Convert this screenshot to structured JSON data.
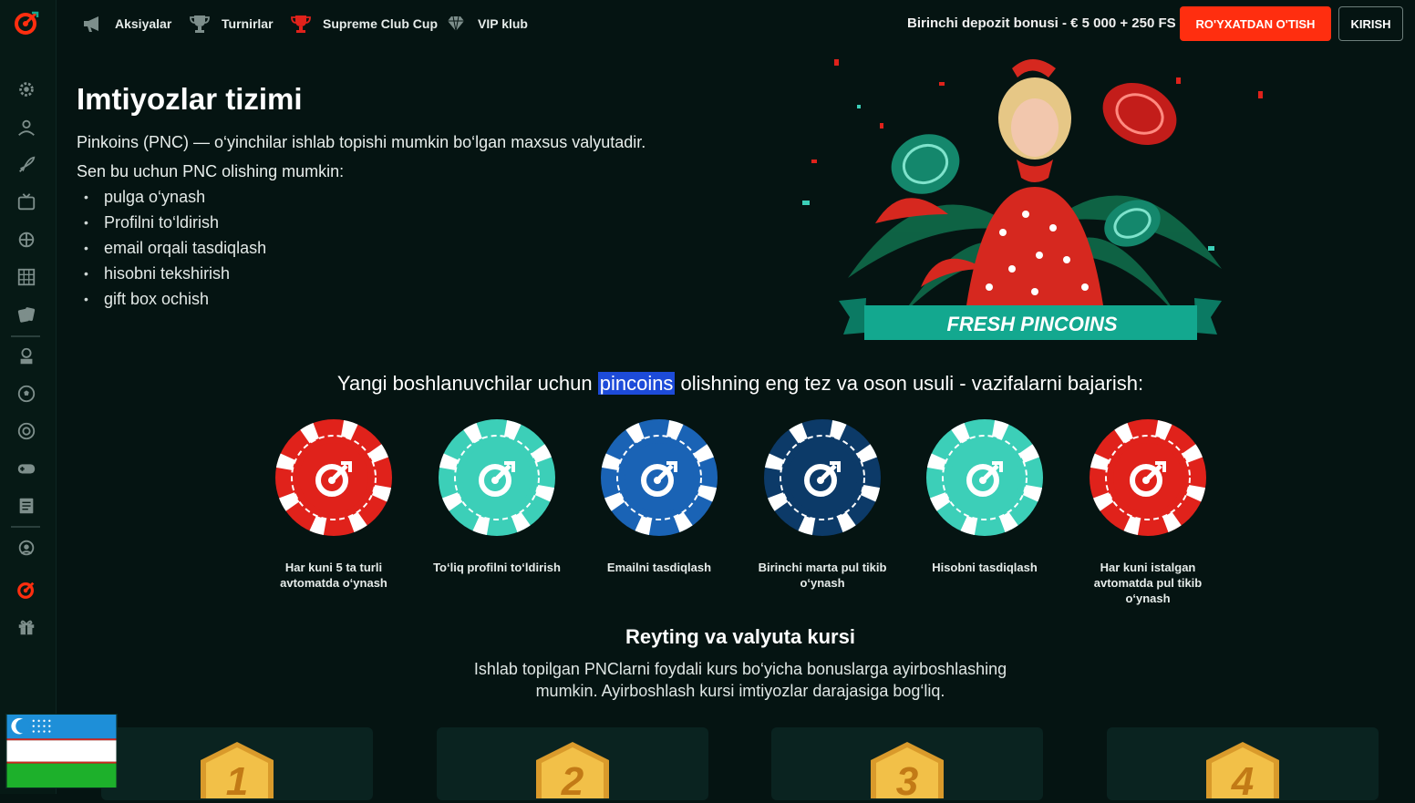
{
  "nav": {
    "items": [
      {
        "label": "Aksiyalar",
        "icon": "megaphone-icon"
      },
      {
        "label": "Turnirlar",
        "icon": "trophy-icon"
      },
      {
        "label": "Supreme Club Cup",
        "icon": "red-trophy-icon"
      },
      {
        "label": "VIP klub",
        "icon": "diamond-icon"
      }
    ],
    "bonus": "Birinchi depozit bonusi - € 5 000 + 250 FS",
    "register": "RO'YXATDAN O'TISH",
    "login": "KIRISH"
  },
  "sidebar": {
    "icons": [
      "settings-gear-icon",
      "live-dealer-icon",
      "rocket-icon",
      "tv-games-icon",
      "poker-table-icon",
      "lottery-grid-icon",
      "cards-icon",
      "esports-icon",
      "football-icon",
      "target-icon",
      "gamepad-icon",
      "news-icon",
      "support-icon",
      "logo-target-icon",
      "gift-icon"
    ]
  },
  "page": {
    "title": "Imtiyozlar tizimi",
    "intro": "Pinkoins (PNC) — o‘yinchilar ishlab topishi mumkin bo‘lgan maxsus valyutadir.",
    "intro2": "Sen bu uchun PNC olishing mumkin:",
    "list": [
      "pulga o‘ynash",
      "Profilni to‘ldirish",
      "email orqali tasdiqlash",
      "hisobni tekshirish",
      "gift box ochish"
    ],
    "banner_text": "FRESH PINCOINS",
    "tasks_heading_pre": "Yangi boshlanuvchilar uchun ",
    "tasks_heading_highlight": "pincoins",
    "tasks_heading_post": " olishning eng tez va oson usuli - vazifalarni bajarish:",
    "chips": [
      {
        "label": "Har kuni 5 ta turli avtomatda o‘ynash",
        "color": "#e0221b"
      },
      {
        "label": "To‘liq profilni to‘ldirish",
        "color": "#3ccfb8"
      },
      {
        "label": "Emailni tasdiqlash",
        "color": "#1a63b5"
      },
      {
        "label": "Birinchi marta pul tikib o‘ynash",
        "color": "#0c3a68"
      },
      {
        "label": "Hisobni tasdiqlash",
        "color": "#3ccfb8"
      },
      {
        "label": "Har kuni istalgan avtomatda pul tikib o‘ynash",
        "color": "#e0221b"
      }
    ],
    "rating_title": "Reyting va valyuta kursi",
    "rating_desc": "Ishlab topilgan PNClarni foydali kurs bo‘yicha bonuslarga ayirboshlashing mumkin. Ayirboshlash kursi imtiyozlar darajasiga bog‘liq.",
    "levels": [
      "1",
      "2",
      "3",
      "4"
    ]
  },
  "colors": {
    "accent": "#ff2e0f",
    "background": "#051412",
    "highlight": "#1d4bd9",
    "teal": "#13a88f"
  }
}
